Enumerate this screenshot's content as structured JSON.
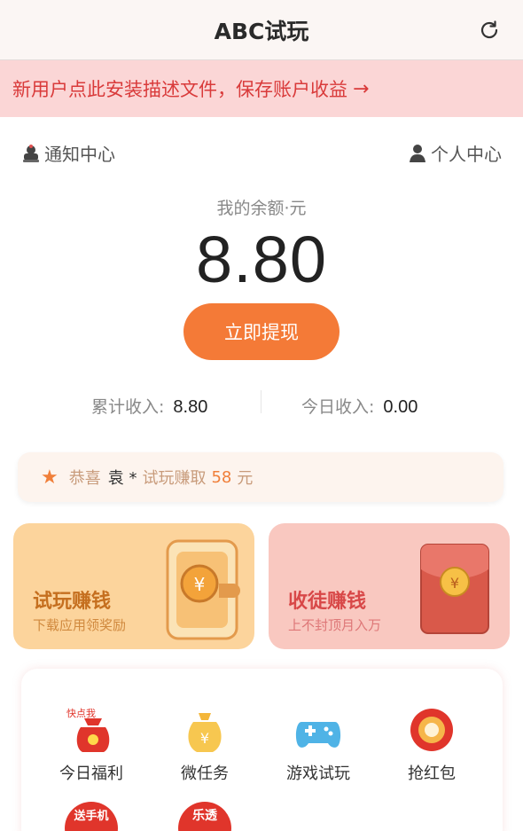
{
  "header": {
    "title": "ABC试玩",
    "refresh_icon": "refresh-icon"
  },
  "notice": {
    "text": "新用户点此安装描述文件，保存账户收益",
    "arrow": "→"
  },
  "links": {
    "notifications": "通知中心",
    "profile": "个人中心"
  },
  "balance": {
    "label": "我的余额·元",
    "value": "8.80",
    "withdraw_label": "立即提现"
  },
  "stats": {
    "total_label": "累计收入:",
    "total_value": "8.80",
    "today_label": "今日收入:",
    "today_value": "0.00"
  },
  "congrats": {
    "prefix": "恭喜",
    "name": "袁 *",
    "middle": "试玩赚取",
    "amount": "58",
    "unit": "元"
  },
  "cards": {
    "trial": {
      "title": "试玩赚钱",
      "subtitle": "下载应用领奖励"
    },
    "collect": {
      "title": "收徒赚钱",
      "subtitle": "上不封顶月入万"
    }
  },
  "grid": {
    "items": [
      {
        "label": "今日福利",
        "badge": "快点我"
      },
      {
        "label": "微任务"
      },
      {
        "label": "游戏试玩"
      },
      {
        "label": "抢红包"
      },
      {
        "label": "",
        "badge": "送手机"
      },
      {
        "label": "",
        "badge": "乐透"
      }
    ]
  },
  "colors": {
    "accent": "#f47a37",
    "notice_bg": "#fbd6d6",
    "notice_text": "#d93a3a"
  }
}
